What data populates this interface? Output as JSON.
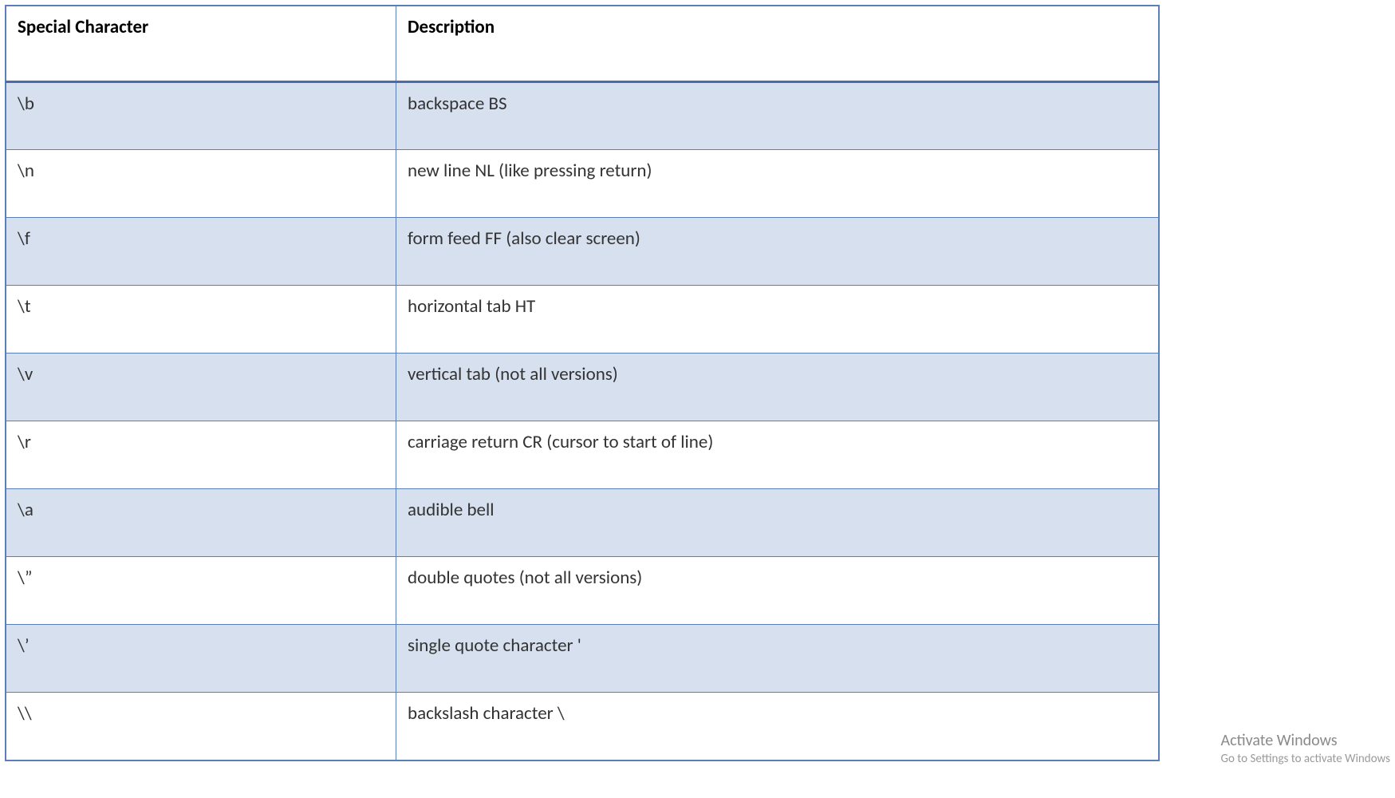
{
  "table": {
    "headers": {
      "col1": "Special Character",
      "col2": "Description"
    },
    "rows": [
      {
        "char": "\\b",
        "desc": "backspace BS"
      },
      {
        "char": "\\n",
        "desc": "new line NL (like pressing return)"
      },
      {
        "char": "\\f",
        "desc": "form feed FF (also clear screen)"
      },
      {
        "char": "\\t",
        "desc": "horizontal tab HT"
      },
      {
        "char": "\\v",
        "desc": "vertical tab (not all versions)"
      },
      {
        "char": "\\r",
        "desc": "carriage return CR (cursor to start of line)"
      },
      {
        "char": "\\a",
        "desc": "audible bell"
      },
      {
        "char": "\\”",
        "desc": "double quotes (not all versions)"
      },
      {
        "char": "\\’",
        "desc": "single quote character '"
      },
      {
        "char": "\\\\",
        "desc": "backslash character \\"
      }
    ]
  },
  "watermark": {
    "title": "Activate Windows",
    "subtitle": "Go to Settings to activate Windows"
  }
}
